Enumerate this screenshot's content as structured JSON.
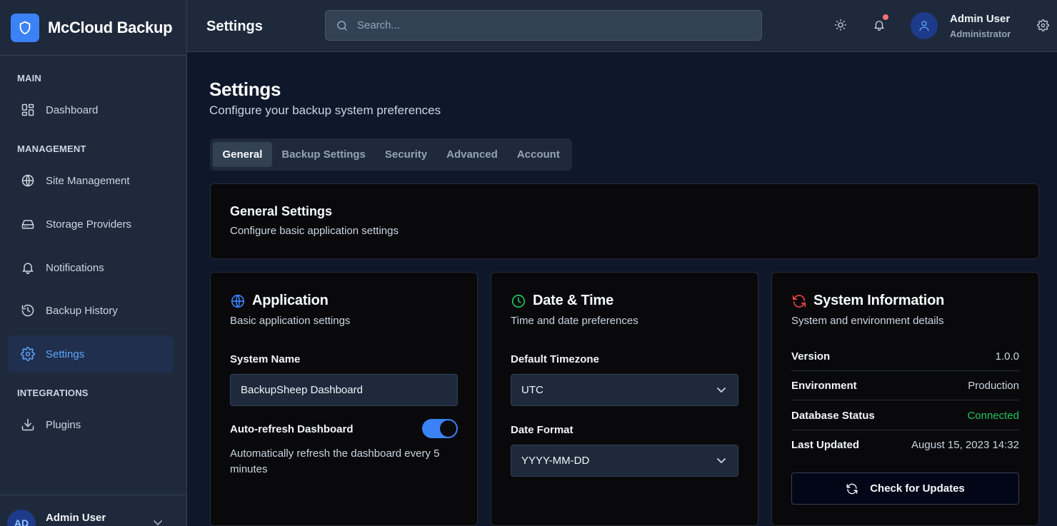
{
  "brand": {
    "name": "McCloud Backup"
  },
  "sidebar": {
    "sections": {
      "main": "MAIN",
      "management": "MANAGEMENT",
      "integrations": "INTEGRATIONS"
    },
    "items": [
      {
        "label": "Dashboard",
        "icon": "dashboard-icon"
      },
      {
        "label": "Site Management",
        "icon": "globe-icon"
      },
      {
        "label": "Storage Providers",
        "icon": "hard-drive-icon"
      },
      {
        "label": "Notifications",
        "icon": "bell-icon"
      },
      {
        "label": "Backup History",
        "icon": "history-icon"
      },
      {
        "label": "Settings",
        "icon": "gear-icon",
        "active": true
      },
      {
        "label": "Plugins",
        "icon": "download-icon"
      }
    ],
    "footer": {
      "initials": "AD",
      "name": "Admin User"
    }
  },
  "header": {
    "title": "Settings",
    "search_placeholder": "Search...",
    "user_name": "Admin User",
    "user_role": "Administrator"
  },
  "page": {
    "title": "Settings",
    "subtitle": "Configure your backup system preferences",
    "tabs": [
      "General",
      "Backup Settings",
      "Security",
      "Advanced",
      "Account"
    ],
    "active_tab": "General"
  },
  "general": {
    "title": "General Settings",
    "subtitle": "Configure basic application settings"
  },
  "application": {
    "title": "Application",
    "subtitle": "Basic application settings",
    "system_name_label": "System Name",
    "system_name_value": "BackupSheep Dashboard",
    "auto_refresh_label": "Auto-refresh Dashboard",
    "auto_refresh_enabled": true,
    "auto_refresh_help": "Automatically refresh the dashboard every 5 minutes"
  },
  "datetime": {
    "title": "Date & Time",
    "subtitle": "Time and date preferences",
    "timezone_label": "Default Timezone",
    "timezone_value": "UTC",
    "date_format_label": "Date Format",
    "date_format_value": "YYYY-MM-DD"
  },
  "system": {
    "title": "System Information",
    "subtitle": "System and environment details",
    "rows": [
      {
        "key": "Version",
        "value": "1.0.0"
      },
      {
        "key": "Environment",
        "value": "Production"
      },
      {
        "key": "Database Status",
        "value": "Connected"
      },
      {
        "key": "Last Updated",
        "value": "August 15, 2023 14:32"
      }
    ],
    "check_button": "Check for Updates"
  },
  "colors": {
    "accent": "#3b82f6",
    "success": "#22c55e",
    "danger": "#ef4444",
    "background": "#0f172a",
    "sidebar": "#1e293b",
    "card": "#09090b"
  }
}
